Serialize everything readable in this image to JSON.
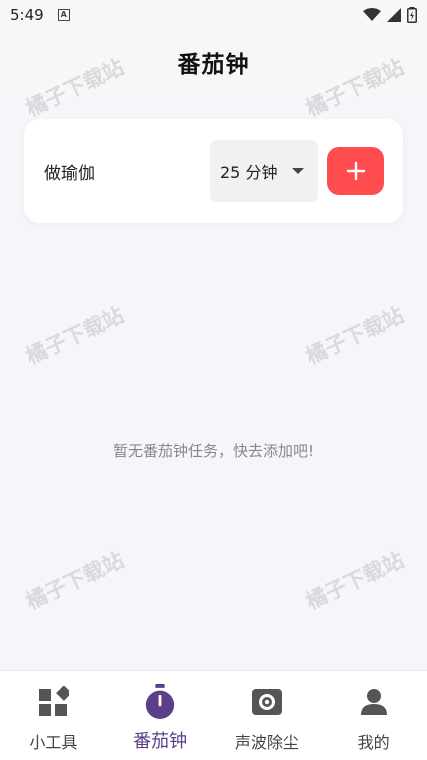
{
  "status_bar": {
    "time": "5:49",
    "badge": "A"
  },
  "header": {
    "title": "番茄钟"
  },
  "task": {
    "input_value": "做瑜伽",
    "duration": "25 分钟"
  },
  "empty_message": "暂无番茄钟任务，快去添加吧!",
  "watermark": "橘子下载站",
  "tabs": [
    {
      "label": "小工具",
      "icon": "grid-shapes-icon"
    },
    {
      "label": "番茄钟",
      "icon": "stopwatch-icon",
      "active": true
    },
    {
      "label": "声波除尘",
      "icon": "speaker-icon"
    },
    {
      "label": "我的",
      "icon": "person-icon"
    }
  ],
  "colors": {
    "accent": "#ff4d4f",
    "active_tab": "#5b3f8a"
  }
}
